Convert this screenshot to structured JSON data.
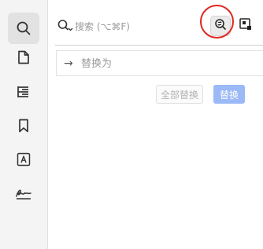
{
  "sidebar": {
    "items": [
      {
        "icon": "search-icon",
        "active": true
      },
      {
        "icon": "page-icon",
        "active": false
      },
      {
        "icon": "outline-icon",
        "active": false
      },
      {
        "icon": "bookmark-icon",
        "active": false
      },
      {
        "icon": "text-box-icon",
        "active": false
      },
      {
        "icon": "signature-icon",
        "active": false
      }
    ]
  },
  "search": {
    "placeholder": "搜索 (⌥⌘F)",
    "value": "",
    "toggle_replace_icon": "replace-toggle-icon",
    "options_icon": "search-options-icon"
  },
  "replace": {
    "arrow": "→",
    "placeholder": "替换为",
    "value": "",
    "replace_all_label": "全部替换",
    "replace_label": "替换"
  },
  "colors": {
    "accent": "#9bb8f7",
    "highlight_circle": "#e0281f",
    "sidebar_bg": "#f4f4f4",
    "disabled_text": "#b2b2b2"
  }
}
